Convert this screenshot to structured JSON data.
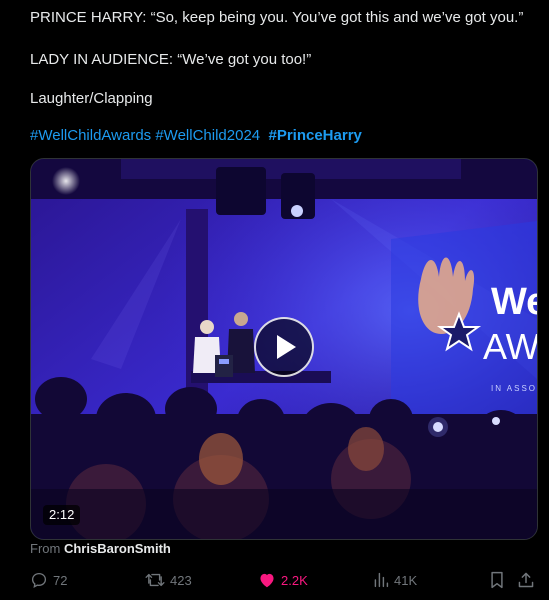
{
  "tweet": {
    "lines": [
      "PRINCE HARRY: “So, keep being you. You’ve got this and we’ve got you.”",
      "LADY IN AUDIENCE: “We’ve got you too!”",
      "Laughter/Clapping"
    ],
    "hashtags": [
      "#WellChildAwards",
      "#WellChild2024",
      "#PrinceHarry"
    ]
  },
  "media": {
    "duration": "2:12",
    "stage_sign_text": [
      "We",
      "AW",
      "IN ASSO"
    ]
  },
  "source": {
    "prefix": "From",
    "author": "ChrisBaronSmith"
  },
  "actions": {
    "replies": "72",
    "reposts": "423",
    "likes": "2.2K",
    "views": "41K"
  },
  "colors": {
    "background": "#000000",
    "text": "#e7e9ea",
    "link": "#1d9bf0",
    "muted": "#71767b",
    "like": "#f91880"
  },
  "icons": [
    "reply-icon",
    "repost-icon",
    "like-icon",
    "views-icon",
    "bookmark-icon",
    "share-icon",
    "play-icon"
  ]
}
